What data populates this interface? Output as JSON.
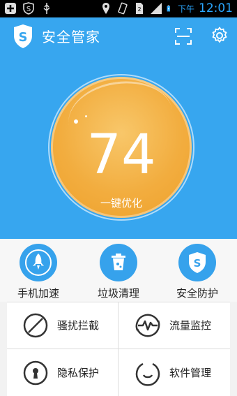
{
  "status_bar": {
    "ampm": "下午",
    "time": "12:01",
    "icons": [
      "plus-icon",
      "s-app-icon",
      "usb-icon",
      "location-icon",
      "vibrate-icon",
      "sim-icon",
      "signal-icon",
      "battery-charging-icon"
    ]
  },
  "header": {
    "title": "安全管家",
    "logo_letter": "S",
    "scan_icon": "scan-icon",
    "settings_icon": "gear-icon"
  },
  "score": {
    "value": "74",
    "action_label": "一键优化"
  },
  "features": [
    {
      "label": "手机加速",
      "icon": "rocket-icon"
    },
    {
      "label": "垃圾清理",
      "icon": "trash-icon"
    },
    {
      "label": "安全防护",
      "icon": "shield-icon"
    }
  ],
  "grid": [
    {
      "label": "骚扰拦截",
      "icon": "block-icon"
    },
    {
      "label": "流量监控",
      "icon": "traffic-icon"
    },
    {
      "label": "隐私保护",
      "icon": "privacy-lock-icon"
    },
    {
      "label": "软件管理",
      "icon": "software-icon"
    }
  ],
  "colors": {
    "accent": "#37a6ef",
    "orb": "#f2ad3f",
    "time": "#2aa7ff"
  }
}
